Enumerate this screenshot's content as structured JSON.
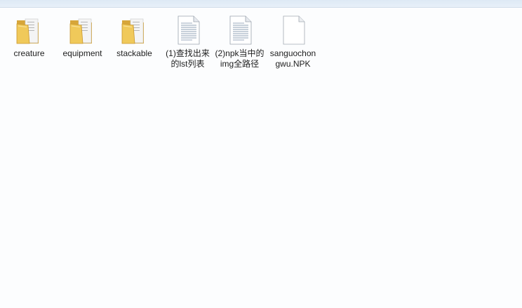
{
  "items": [
    {
      "label": "creature",
      "type": "folder",
      "icon": "folder-icon"
    },
    {
      "label": "equipment",
      "type": "folder",
      "icon": "folder-icon"
    },
    {
      "label": "stackable",
      "type": "folder",
      "icon": "folder-icon"
    },
    {
      "label": "(1)查找出来的lst列表",
      "type": "text-document",
      "icon": "text-document-icon"
    },
    {
      "label": "(2)npk当中的img全路径",
      "type": "text-document",
      "icon": "text-document-icon"
    },
    {
      "label": "sanguochongwu.NPK",
      "type": "file",
      "icon": "blank-file-icon"
    }
  ],
  "colors": {
    "background": "#fcfdfe",
    "folder": "#f0c95a",
    "text": "#1e1e1e"
  }
}
